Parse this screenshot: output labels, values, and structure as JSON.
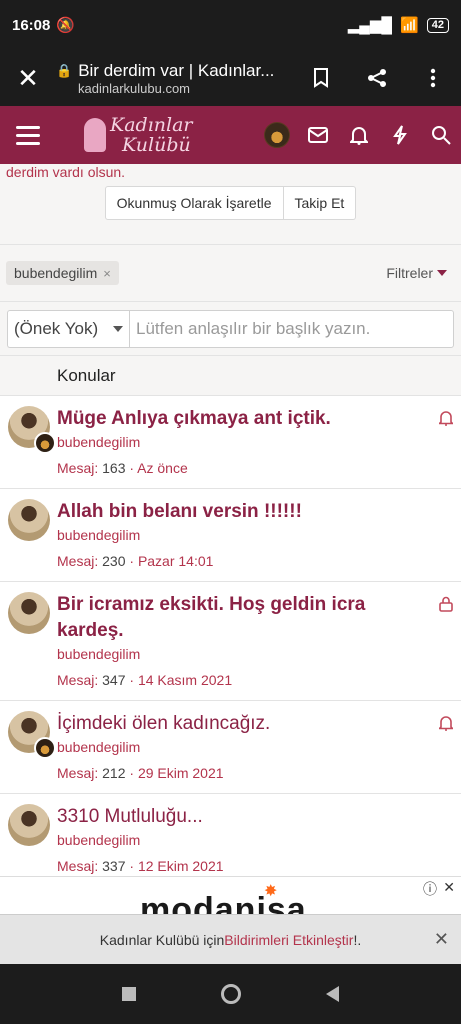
{
  "status_bar": {
    "time": "16:08",
    "battery": "42"
  },
  "browser": {
    "title": "Bir derdim var | Kadınlar...",
    "domain": "kadinlarkulubu.com"
  },
  "site": {
    "logo_line1": "Kadınlar",
    "logo_line2": "Kulübü",
    "brand_color": "#8b2245"
  },
  "thread_header": {
    "snippet": "derdim vardı olsun.",
    "mark_read": "Okunmuş Olarak İşaretle",
    "follow": "Takip Et"
  },
  "filter": {
    "tag": "bubendegilim",
    "tag_remove": "×",
    "filters_label": "Filtreler"
  },
  "new_thread": {
    "prefix": "(Önek Yok)",
    "placeholder": "Lütfen anlaşılır bir başlık yazın."
  },
  "list": {
    "header": "Konular",
    "threads": [
      {
        "title": "Müge Anlıya çıkmaya ant içtik.",
        "author": "bubendegilim",
        "replies_label": "Mesaj:",
        "replies": "163",
        "date": "Az önce",
        "status_icon": "bell-icon",
        "unread": true
      },
      {
        "title": "Allah bin belanı versin !!!!!!",
        "author": "bubendegilim",
        "replies_label": "Mesaj:",
        "replies": "230",
        "date": "Pazar 14:01",
        "status_icon": "",
        "unread": true
      },
      {
        "title": "Bir icramız eksikti. Hoş geldin icra kardeş.",
        "author": "bubendegilim",
        "replies_label": "Mesaj:",
        "replies": "347",
        "date": "14 Kasım 2021",
        "status_icon": "lock-icon",
        "unread": true
      },
      {
        "title": "İçimdeki ölen kadıncağız.",
        "author": "bubendegilim",
        "replies_label": "Mesaj:",
        "replies": "212",
        "date": "29 Ekim 2021",
        "status_icon": "bell-icon",
        "unread": false
      },
      {
        "title": "3310 Mutluluğu...",
        "author": "bubendegilim",
        "replies_label": "Mesaj:",
        "replies": "337",
        "date": "12 Ekim 2021",
        "status_icon": "",
        "unread": false
      }
    ]
  },
  "ad": {
    "brand": "modanisa"
  },
  "notification_bar": {
    "prefix": "Kadınlar Kulübü için ",
    "link": "Bildirimleri Etkinleştir",
    "suffix": " !."
  }
}
